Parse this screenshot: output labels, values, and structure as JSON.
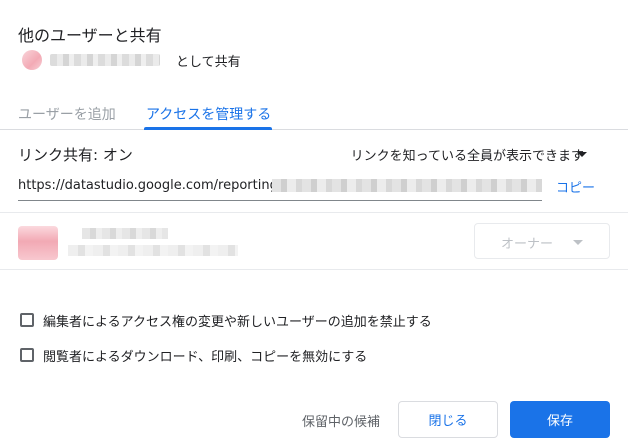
{
  "dialog": {
    "title": "他のユーザーと共有"
  },
  "owner": {
    "suffix": "として共有"
  },
  "tabs": [
    {
      "label": "ユーザーを追加",
      "active": false
    },
    {
      "label": "アクセスを管理する",
      "active": true
    }
  ],
  "link": {
    "status": "リンク共有: オン",
    "scope": "リンクを知っている全員が表示できます",
    "url_prefix": "https://datastudio.google.com/reporting/",
    "copy_label": "コピー"
  },
  "member": {
    "role": "オーナー"
  },
  "options": [
    {
      "label": "編集者によるアクセス権の変更や新しいユーザーの追加を禁止する",
      "checked": false
    },
    {
      "label": "閲覧者によるダウンロード、印刷、コピーを無効にする",
      "checked": false
    }
  ],
  "footer": {
    "pending_label": "保留中の候補",
    "close_label": "閉じる",
    "save_label": "保存"
  },
  "colors": {
    "accent": "#1a73e8",
    "text": "#202124",
    "muted": "#5f6368",
    "disabled": "#bdc1c6"
  }
}
